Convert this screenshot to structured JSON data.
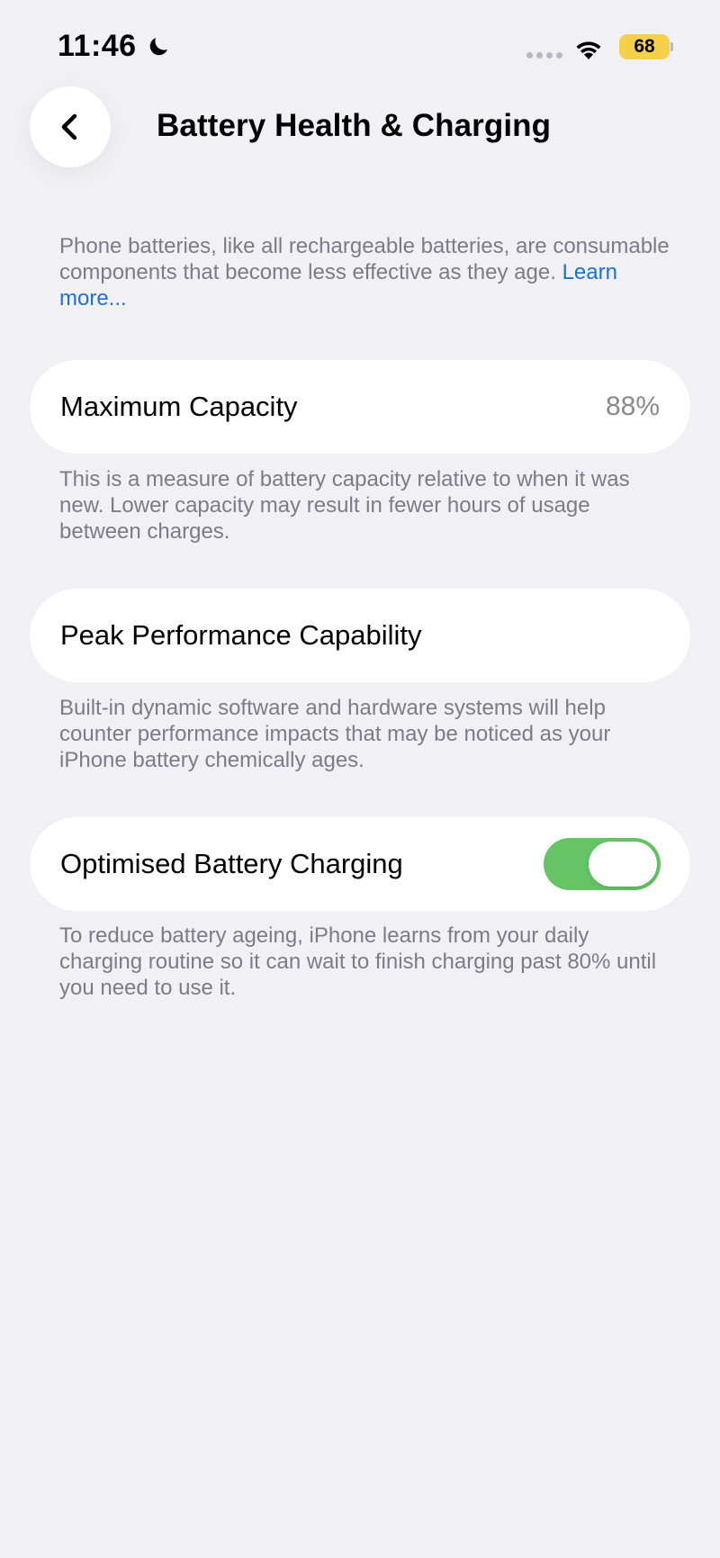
{
  "status_bar": {
    "time": "11:46",
    "battery_level": "68",
    "battery_color": "#F5D04B"
  },
  "nav": {
    "back_icon": "chevron-left-icon",
    "title": "Battery Health & Charging"
  },
  "intro": {
    "text": "Phone batteries, like all rechargeable batteries, are consumable components that become less effective as they age.",
    "link": "Learn more..."
  },
  "maximum_capacity": {
    "label": "Maximum Capacity",
    "value": "88%",
    "description": "This is a measure of battery capacity relative to when it was new. Lower capacity may result in fewer hours of usage between charges."
  },
  "peak_performance": {
    "label": "Peak Performance Capability",
    "description": "Built-in dynamic software and hardware systems will help counter performance impacts that may be noticed as your iPhone battery chemically ages."
  },
  "optimised_charging": {
    "label": "Optimised Battery Charging",
    "enabled": true,
    "toggle_color": "#65C466",
    "description": "To reduce battery ageing, iPhone learns from your daily charging routine so it can wait to finish charging past 80% until you need to use it."
  }
}
